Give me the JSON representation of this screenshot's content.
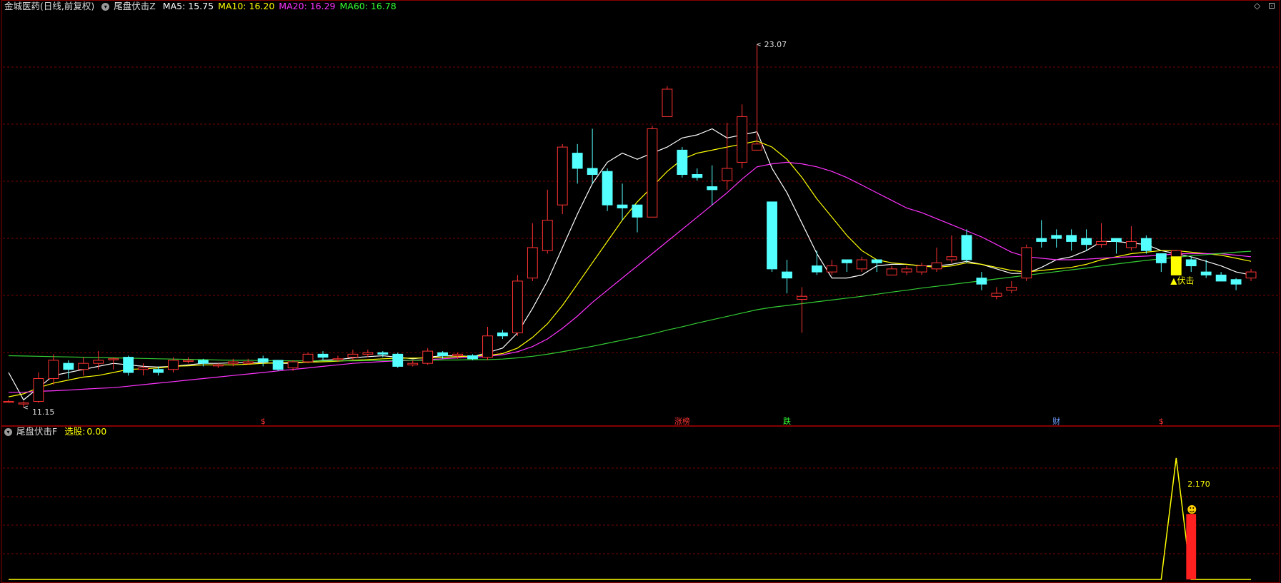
{
  "header": {
    "stock_name": "金城医药",
    "period": "(日线,前复权)",
    "main_indicator": "尾盘伏击Z",
    "ma": [
      {
        "label": "MA5:",
        "value": "15.75",
        "color": "#ffffff"
      },
      {
        "label": "MA10:",
        "value": "16.20",
        "color": "#ffff00"
      },
      {
        "label": "MA20:",
        "value": "16.29",
        "color": "#ff33ff"
      },
      {
        "label": "MA60:",
        "value": "16.78",
        "color": "#33ff33"
      }
    ]
  },
  "sub_header": {
    "indicator": "尾盘伏击F",
    "select_label": "选股:",
    "select_value": "0.00"
  },
  "icons": [
    "collapse-icon",
    "diamond-icon",
    "window-icon"
  ],
  "colors": {
    "up": "#ff3333",
    "down": "#54ffff",
    "ma5": "#ffffff",
    "ma10": "#ffff00",
    "ma20": "#ff33ff",
    "ma60": "#33cc33",
    "signal": "#ffff00",
    "grid": "#7a0000"
  },
  "event_markers": [
    {
      "text": "$",
      "color": "#ff3333"
    },
    {
      "text": "涨榜",
      "color": "#ff3333"
    },
    {
      "text": "跌",
      "color": "#33ff33"
    },
    {
      "text": "财",
      "color": "#6fa0ff"
    },
    {
      "text": "$",
      "color": "#ff3333"
    }
  ],
  "chart_data": [
    {
      "type": "candlestick",
      "title": "金城医药 日线 尾盘伏击Z",
      "ylim": [
        10.8,
        24.2
      ],
      "annotations": {
        "high_label": "23.07",
        "low_label": "11.15",
        "signal_label": "▲伏击"
      },
      "candles": [
        [
          11.35,
          11.35,
          11.4,
          11.3
        ],
        [
          11.3,
          11.3,
          11.35,
          11.15
        ],
        [
          11.35,
          12.1,
          12.3,
          11.3
        ],
        [
          12.1,
          12.7,
          12.9,
          11.9
        ],
        [
          12.6,
          12.4,
          12.7,
          12.1
        ],
        [
          12.4,
          12.6,
          12.8,
          12.2
        ],
        [
          12.6,
          12.7,
          13.0,
          12.4
        ],
        [
          12.75,
          12.75,
          12.8,
          12.4
        ],
        [
          12.8,
          12.3,
          12.85,
          12.2
        ],
        [
          12.4,
          12.45,
          12.6,
          12.2
        ],
        [
          12.4,
          12.3,
          12.5,
          12.2
        ],
        [
          12.4,
          12.7,
          12.8,
          12.3
        ],
        [
          12.7,
          12.7,
          12.8,
          12.6
        ],
        [
          12.7,
          12.6,
          12.75,
          12.5
        ],
        [
          12.55,
          12.55,
          12.6,
          12.45
        ],
        [
          12.6,
          12.65,
          12.75,
          12.5
        ],
        [
          12.6,
          12.65,
          12.75,
          12.55
        ],
        [
          12.75,
          12.65,
          12.85,
          12.5
        ],
        [
          12.7,
          12.4,
          12.7,
          12.35
        ],
        [
          12.45,
          12.65,
          12.7,
          12.35
        ],
        [
          12.65,
          12.9,
          12.95,
          12.6
        ],
        [
          12.9,
          12.8,
          13.0,
          12.7
        ],
        [
          12.75,
          12.75,
          12.85,
          12.65
        ],
        [
          12.8,
          12.9,
          13.05,
          12.7
        ],
        [
          12.9,
          12.95,
          13.05,
          12.8
        ],
        [
          12.95,
          12.9,
          13.0,
          12.8
        ],
        [
          12.9,
          12.5,
          12.95,
          12.45
        ],
        [
          12.55,
          12.6,
          12.7,
          12.5
        ],
        [
          12.6,
          13.0,
          13.1,
          12.55
        ],
        [
          12.95,
          12.85,
          13.0,
          12.75
        ],
        [
          12.85,
          12.9,
          12.95,
          12.75
        ],
        [
          12.85,
          12.75,
          12.9,
          12.7
        ],
        [
          12.8,
          13.5,
          13.8,
          12.7
        ],
        [
          13.6,
          13.5,
          13.7,
          13.4
        ],
        [
          13.6,
          15.3,
          15.5,
          13.5
        ],
        [
          15.4,
          16.4,
          17.2,
          15.3
        ],
        [
          16.3,
          17.3,
          18.3,
          16.2
        ],
        [
          17.8,
          19.7,
          19.8,
          17.5
        ],
        [
          19.5,
          19.0,
          19.8,
          18.5
        ],
        [
          19.0,
          18.8,
          20.3,
          18.5
        ],
        [
          18.9,
          17.8,
          19.0,
          17.6
        ],
        [
          17.8,
          17.7,
          18.5,
          17.3
        ],
        [
          17.8,
          17.4,
          17.8,
          16.9
        ],
        [
          17.4,
          20.3,
          20.4,
          17.4
        ],
        [
          20.7,
          21.6,
          21.7,
          20.7
        ],
        [
          19.6,
          18.8,
          19.7,
          18.7
        ],
        [
          18.8,
          18.7,
          19.0,
          18.6
        ],
        [
          18.4,
          18.3,
          19.1,
          17.8
        ],
        [
          18.6,
          19.0,
          20.5,
          18.3
        ],
        [
          19.2,
          20.7,
          21.1,
          19.0
        ],
        [
          19.6,
          19.8,
          23.07,
          19.6
        ],
        [
          17.9,
          15.7,
          17.9,
          15.6
        ],
        [
          15.6,
          15.4,
          16.0,
          14.9
        ],
        [
          14.7,
          14.8,
          15.1,
          13.6
        ],
        [
          15.8,
          15.6,
          16.3,
          15.5
        ],
        [
          15.6,
          15.8,
          16.0,
          15.5
        ],
        [
          16.0,
          15.9,
          16.0,
          15.6
        ],
        [
          15.7,
          16.0,
          16.1,
          15.6
        ],
        [
          16.0,
          15.9,
          16.0,
          15.6
        ],
        [
          15.5,
          15.7,
          15.8,
          15.5
        ],
        [
          15.6,
          15.7,
          15.8,
          15.5
        ],
        [
          15.6,
          15.8,
          15.9,
          15.5
        ],
        [
          15.7,
          15.9,
          16.4,
          15.6
        ],
        [
          16.0,
          16.1,
          16.8,
          15.9
        ],
        [
          16.8,
          16.0,
          17.0,
          15.9
        ],
        [
          15.4,
          15.2,
          15.6,
          15.0
        ],
        [
          14.8,
          14.9,
          15.1,
          14.7
        ],
        [
          15.0,
          15.1,
          15.3,
          14.9
        ],
        [
          15.4,
          16.4,
          16.5,
          15.3
        ],
        [
          16.7,
          16.6,
          17.3,
          16.4
        ],
        [
          16.8,
          16.7,
          17.0,
          16.4
        ],
        [
          16.8,
          16.6,
          17.0,
          16.3
        ],
        [
          16.7,
          16.5,
          17.0,
          16.3
        ],
        [
          16.5,
          16.6,
          17.2,
          16.4
        ],
        [
          16.7,
          16.6,
          16.7,
          16.2
        ],
        [
          16.4,
          16.6,
          17.1,
          16.3
        ],
        [
          16.7,
          16.3,
          16.8,
          16.2
        ],
        [
          16.2,
          15.9,
          16.2,
          15.6
        ],
        [
          15.9,
          16.3,
          16.3,
          15.9
        ],
        [
          16.0,
          15.8,
          16.1,
          15.6
        ],
        [
          15.6,
          15.5,
          16.0,
          15.4
        ],
        [
          15.5,
          15.3,
          15.6,
          15.3
        ],
        [
          15.35,
          15.2,
          15.4,
          15.0
        ],
        [
          15.4,
          15.6,
          15.7,
          15.3
        ]
      ],
      "series": [
        {
          "name": "MA5",
          "values": [
            12.3,
            11.4,
            11.8,
            12.2,
            12.3,
            12.4,
            12.5,
            12.6,
            12.55,
            12.5,
            12.48,
            12.5,
            12.55,
            12.6,
            12.6,
            12.62,
            12.63,
            12.62,
            12.6,
            12.6,
            12.65,
            12.7,
            12.72,
            12.78,
            12.82,
            12.85,
            12.8,
            12.75,
            12.8,
            12.85,
            12.85,
            12.82,
            12.95,
            13.1,
            13.6,
            14.4,
            15.3,
            16.4,
            17.5,
            18.5,
            19.2,
            19.5,
            19.3,
            19.5,
            19.7,
            20.0,
            20.1,
            20.3,
            20.0,
            20.1,
            20.2,
            19.0,
            18.2,
            17.2,
            16.2,
            15.4,
            15.4,
            15.5,
            15.8,
            15.85,
            15.85,
            15.8,
            15.8,
            15.85,
            15.95,
            15.85,
            15.7,
            15.55,
            15.55,
            15.75,
            16.0,
            16.1,
            16.3,
            16.6,
            16.6,
            16.55,
            16.5,
            16.3,
            16.2,
            16.1,
            15.95,
            15.8,
            15.6,
            15.5
          ]
        },
        {
          "name": "MA10",
          "values": [
            11.5,
            11.6,
            11.8,
            11.95,
            12.05,
            12.15,
            12.2,
            12.3,
            12.4,
            12.42,
            12.45,
            12.5,
            12.52,
            12.55,
            12.55,
            12.55,
            12.57,
            12.6,
            12.62,
            12.63,
            12.64,
            12.65,
            12.67,
            12.7,
            12.72,
            12.75,
            12.77,
            12.77,
            12.78,
            12.8,
            12.82,
            12.84,
            12.86,
            12.92,
            13.1,
            13.45,
            13.9,
            14.5,
            15.2,
            15.9,
            16.6,
            17.3,
            17.9,
            18.4,
            18.9,
            19.3,
            19.5,
            19.6,
            19.7,
            19.8,
            19.9,
            19.7,
            19.3,
            18.7,
            18.0,
            17.4,
            16.8,
            16.3,
            16.0,
            15.9,
            15.85,
            15.8,
            15.75,
            15.8,
            15.9,
            15.85,
            15.75,
            15.65,
            15.6,
            15.65,
            15.7,
            15.75,
            15.85,
            16.0,
            16.1,
            16.2,
            16.25,
            16.3,
            16.3,
            16.25,
            16.2,
            16.15,
            16.05,
            15.95
          ]
        },
        {
          "name": "MA20",
          "values": [
            11.65,
            11.65,
            11.68,
            11.7,
            11.72,
            11.75,
            11.78,
            11.8,
            11.85,
            11.9,
            11.95,
            12.0,
            12.05,
            12.1,
            12.15,
            12.2,
            12.25,
            12.3,
            12.35,
            12.4,
            12.45,
            12.5,
            12.55,
            12.6,
            12.63,
            12.66,
            12.68,
            12.7,
            12.72,
            12.75,
            12.78,
            12.8,
            12.83,
            12.88,
            12.98,
            13.15,
            13.4,
            13.75,
            14.15,
            14.6,
            15.0,
            15.4,
            15.8,
            16.2,
            16.6,
            17.0,
            17.4,
            17.8,
            18.2,
            18.65,
            19.05,
            19.15,
            19.2,
            19.15,
            19.05,
            18.9,
            18.7,
            18.45,
            18.2,
            17.95,
            17.7,
            17.55,
            17.35,
            17.15,
            16.95,
            16.75,
            16.5,
            16.25,
            16.1,
            16.05,
            16.0,
            16.0,
            16.02,
            16.05,
            16.08,
            16.1,
            16.12,
            16.15,
            16.2,
            16.2,
            16.2,
            16.2,
            16.15,
            16.1
          ]
        },
        {
          "name": "MA60",
          "values": [
            12.85,
            12.84,
            12.83,
            12.82,
            12.81,
            12.8,
            12.79,
            12.78,
            12.77,
            12.76,
            12.75,
            12.74,
            12.73,
            12.72,
            12.71,
            12.7,
            12.7,
            12.69,
            12.69,
            12.68,
            12.68,
            12.68,
            12.68,
            12.68,
            12.69,
            12.69,
            12.7,
            12.7,
            12.7,
            12.71,
            12.71,
            12.72,
            12.72,
            12.74,
            12.78,
            12.83,
            12.9,
            12.98,
            13.07,
            13.16,
            13.26,
            13.36,
            13.46,
            13.57,
            13.69,
            13.8,
            13.92,
            14.03,
            14.14,
            14.25,
            14.36,
            14.44,
            14.5,
            14.56,
            14.62,
            14.68,
            14.74,
            14.8,
            14.87,
            14.94,
            15.0,
            15.07,
            15.13,
            15.19,
            15.25,
            15.31,
            15.37,
            15.43,
            15.49,
            15.55,
            15.61,
            15.67,
            15.73,
            15.8,
            15.86,
            15.92,
            15.98,
            16.03,
            16.08,
            16.13,
            16.17,
            16.21,
            16.25,
            16.28
          ]
        }
      ],
      "signal_bar": {
        "index": 78,
        "open": 16.1,
        "close": 15.5
      }
    },
    {
      "type": "line",
      "title": "尾盘伏击F",
      "ylim": [
        0,
        2.5
      ],
      "series": [
        {
          "name": "选股",
          "values": [
            0,
            0,
            0,
            0,
            0,
            0,
            0,
            0,
            0,
            0,
            0,
            0,
            0,
            0,
            0,
            0,
            0,
            0,
            0,
            0,
            0,
            0,
            0,
            0,
            0,
            0,
            0,
            0,
            0,
            0,
            0,
            0,
            0,
            0,
            0,
            0,
            0,
            0,
            0,
            0,
            0,
            0,
            0,
            0,
            0,
            0,
            0,
            0,
            0,
            0,
            0,
            0,
            0,
            0,
            0,
            0,
            0,
            0,
            0,
            0,
            0,
            0,
            0,
            0,
            0,
            0,
            0,
            0,
            0,
            0,
            0,
            0,
            0,
            0,
            0,
            0,
            0,
            0,
            2.17,
            0,
            0,
            0,
            0,
            0
          ]
        }
      ],
      "bars": [
        {
          "index": 79,
          "value": 1.17
        }
      ],
      "annotations": {
        "peak_label": "2.170"
      }
    }
  ]
}
